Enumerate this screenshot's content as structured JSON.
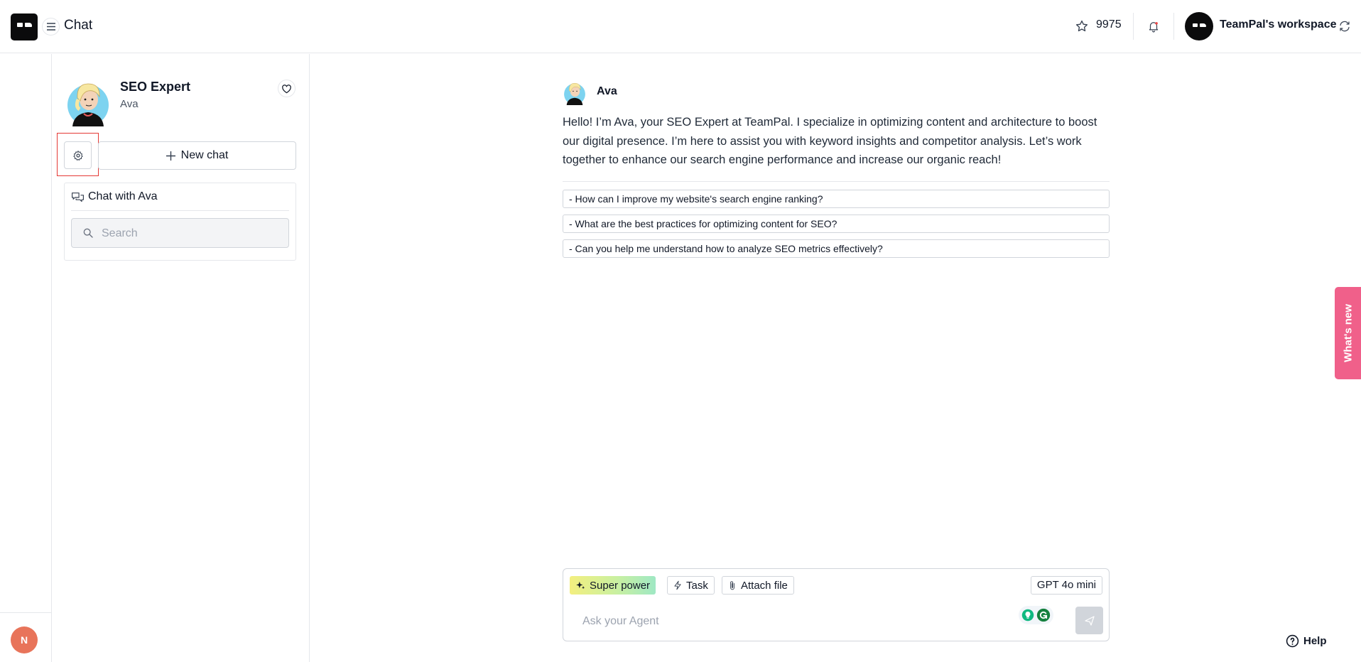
{
  "header": {
    "page_title": "Chat",
    "credits": "9975",
    "workspace_name": "TeamPal's workspace"
  },
  "rail": {
    "user_initial": "N"
  },
  "agent": {
    "name": "SEO Expert",
    "persona": "Ava",
    "new_chat_label": "New chat",
    "history_title": "Chat with Ava",
    "search_placeholder": "Search"
  },
  "chat": {
    "sender": "Ava",
    "message": "Hello! I’m Ava, your SEO Expert at TeamPal. I specialize in optimizing content and architecture to boost our digital presence. I’m here to assist you with keyword insights and competitor analysis. Let’s work together to enhance our search engine performance and increase our organic reach!",
    "suggestions": [
      "- How can I improve my website's search engine ranking?",
      "- What are the best practices for optimizing content for SEO?",
      "- Can you help me understand how to analyze SEO metrics effectively?"
    ]
  },
  "composer": {
    "superpower_label": "Super power",
    "task_label": "Task",
    "attach_label": "Attach file",
    "model_label": "GPT 4o mini",
    "placeholder": "Ask your Agent"
  },
  "whats_new_label": "What's new",
  "help_label": "Help",
  "colors": {
    "whats_new": "#f0608a",
    "highlight": "#e53935",
    "avatar_user": "#e8745a"
  },
  "icons": [
    "menu-icon",
    "star-icon",
    "bell-icon",
    "switch-icon",
    "heart-icon",
    "gear-icon",
    "plus-icon",
    "chat-bubbles-icon",
    "search-icon",
    "sparkle-icon",
    "bolt-icon",
    "paperclip-icon",
    "send-icon",
    "help-icon"
  ]
}
